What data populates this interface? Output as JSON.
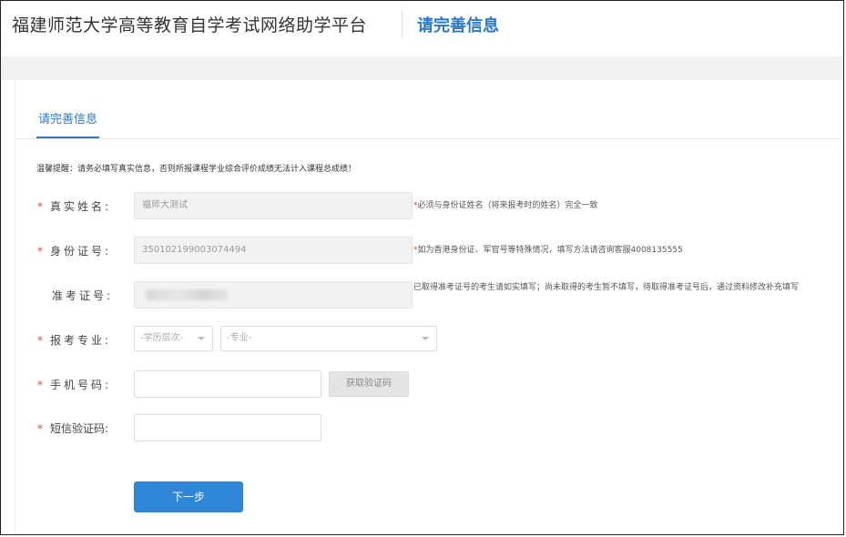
{
  "header": {
    "site_title": "福建师范大学高等教育自学考试网络助学平台",
    "subtitle": "请完善信息"
  },
  "tab": {
    "label": "请完善信息"
  },
  "notice": "温馨提醒：请务必填写真实信息，否则所报课程学业综合评价成绩无法计入课程总成绩！",
  "form": {
    "name": {
      "required_mark": "*",
      "label": "真实姓名:",
      "value": "福师大测试",
      "hint_star": "*",
      "hint": "必须与身份证姓名（将来报考时的姓名）完全一致"
    },
    "idcard": {
      "required_mark": "*",
      "label": "身份证号:",
      "value": "350102199003074494",
      "hint_star": "*",
      "hint": "如为香港身份证、军官号等特殊情况，填写方法请咨询客服4008135555"
    },
    "admission": {
      "label": "准考证号:",
      "hint": "已取得准考证号的考生请如实填写；尚未取得的考生暂不填写，待取得准考证号后，通过资料修改补充填写"
    },
    "major": {
      "required_mark": "*",
      "label": "报考专业:",
      "level_placeholder": "-学历层次-",
      "major_placeholder": "-专业-"
    },
    "phone": {
      "required_mark": "*",
      "label": "手机号码:",
      "value": "",
      "code_button": "获取验证码"
    },
    "sms": {
      "required_mark": "*",
      "label": "短信验证码:",
      "value": ""
    }
  },
  "next_button": "下一步",
  "colors": {
    "accent": "#2a78c9",
    "required": "#e04a3a",
    "button": "#2f86d8"
  }
}
